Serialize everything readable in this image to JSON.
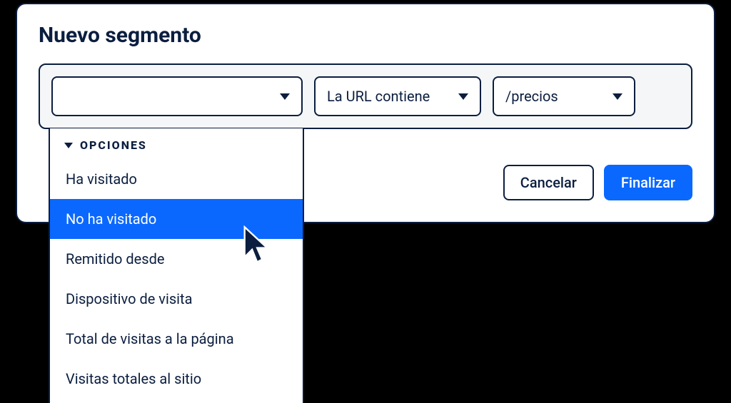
{
  "modal": {
    "title": "Nuevo segmento"
  },
  "filters": {
    "field": {
      "value": ""
    },
    "operator": {
      "value": "La URL contiene"
    },
    "value": {
      "value": "/precios"
    }
  },
  "dropdown": {
    "header": "Opciones",
    "items": [
      {
        "label": "Ha visitado"
      },
      {
        "label": "No ha visitado"
      },
      {
        "label": "Remitido desde"
      },
      {
        "label": "Dispositivo de visita"
      },
      {
        "label": "Total de visitas a la página"
      },
      {
        "label": "Visitas totales al sitio"
      }
    ],
    "highlight_index": 1
  },
  "actions": {
    "cancel": "Cancelar",
    "finish": "Finalizar"
  },
  "colors": {
    "ink": "#0b1e3f",
    "accent": "#0a68ff"
  }
}
